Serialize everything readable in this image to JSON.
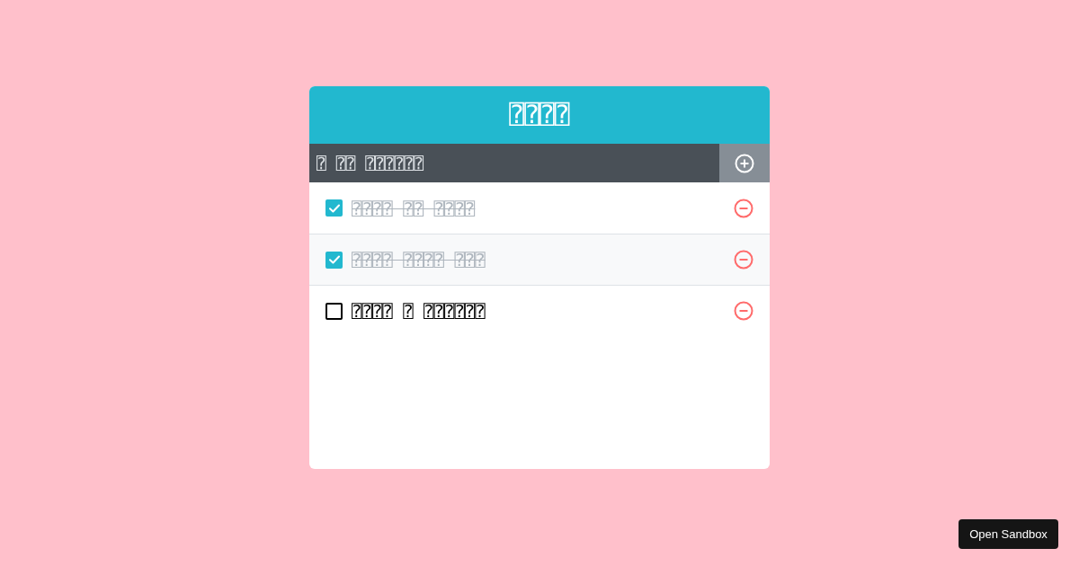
{
  "app": {
    "title": "⍰⍰⍰⍰"
  },
  "new_todo": {
    "placeholder": "⍰ ⍰⍰ ⍰⍰⍰⍰⍰⍰"
  },
  "todos": [
    {
      "text": "⍰⍰⍰⍰ ⍰⍰ ⍰⍰⍰⍰",
      "checked": true
    },
    {
      "text": "⍰⍰⍰⍰ ⍰⍰⍰⍰ ⍰⍰⍰",
      "checked": true
    },
    {
      "text": "⍰⍰⍰⍰ ⍰ ⍰⍰⍰⍰⍰⍰",
      "checked": false
    }
  ],
  "sandbox_button": {
    "label": "Open Sandbox"
  }
}
